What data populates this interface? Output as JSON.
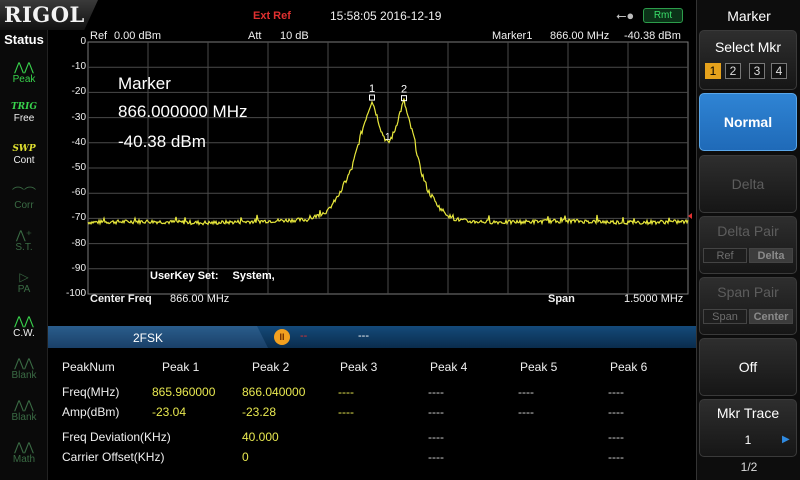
{
  "header": {
    "logo": "RIGOL",
    "ext_ref": "Ext Ref",
    "datetime": "15:58:05 2016-12-19",
    "usb_icon": "usb-icon",
    "rmt": "Rmt"
  },
  "status": {
    "title": "Status",
    "items": [
      {
        "icon": "peak-icon",
        "label": "Peak",
        "on": true
      },
      {
        "text": "TRIG",
        "label": "Free",
        "on": true
      },
      {
        "text": "SWP",
        "label": "Cont",
        "on": true
      },
      {
        "icon": "corr-icon",
        "label": "Corr",
        "on": false
      },
      {
        "icon": "st-icon",
        "label": "S.T.",
        "on": false
      },
      {
        "icon": "pa-icon",
        "label": "PA",
        "on": false
      },
      {
        "icon": "cw-icon",
        "label": "C.W.",
        "on": true
      },
      {
        "icon": "blank-icon",
        "label": "Blank",
        "on": false
      },
      {
        "icon": "blank-icon",
        "label": "Blank",
        "on": false
      },
      {
        "icon": "math-icon",
        "label": "Math",
        "on": false
      }
    ]
  },
  "plot": {
    "ref_label": "Ref",
    "ref_value": "0.00 dBm",
    "att_label": "Att",
    "att_value": "10 dB",
    "marker_hdr_label": "Marker1",
    "marker_hdr_freq": "866.00 MHz",
    "marker_hdr_amp": "-40.38 dBm",
    "y_ticks": [
      "0",
      "-10",
      "-20",
      "-30",
      "-40",
      "-50",
      "-60",
      "-70",
      "-80",
      "-90",
      "-100"
    ],
    "marker_info": [
      "Marker",
      "866.000000 MHz",
      "-40.38 dBm"
    ],
    "userkey_label": "UserKey Set:",
    "userkey_value": "System,",
    "center_label": "Center Freq",
    "center_value": "866.00 MHz",
    "span_label": "Span",
    "span_value": "1.5000 MHz",
    "trace_color": "#e8e83c",
    "marker_labels": [
      "1",
      "2",
      "1"
    ]
  },
  "chart_data": {
    "type": "line",
    "x_center_mhz": 866.0,
    "x_span_mhz": 1.5,
    "ylim": [
      -100,
      0
    ],
    "grid": true,
    "series": [
      {
        "x": [
          865.25,
          865.4,
          865.55,
          865.7,
          865.8,
          865.85,
          865.88,
          865.91,
          865.93,
          865.945,
          865.96,
          865.97,
          865.985,
          866.0,
          866.015,
          866.03,
          866.04,
          866.05,
          866.065,
          866.08,
          866.1,
          866.13,
          866.16,
          866.2,
          866.3,
          866.45,
          866.6,
          866.75
        ],
        "y": [
          -71.5,
          -71.2,
          -71.8,
          -71.0,
          -70.5,
          -67,
          -60,
          -50,
          -38,
          -30,
          -23.04,
          -28,
          -36,
          -40.38,
          -36,
          -28,
          -23.28,
          -30,
          -38,
          -50,
          -59,
          -66,
          -70,
          -71.2,
          -71.5,
          -71.0,
          -71.6,
          -71.3
        ]
      }
    ],
    "markers": [
      {
        "label": "1",
        "freq": 865.96,
        "amp": -23.04
      },
      {
        "label": "2",
        "freq": 866.04,
        "amp": -23.28
      },
      {
        "label": "1",
        "freq": 866.0,
        "amp": -40.38
      }
    ]
  },
  "measurement": {
    "name": "2FSK",
    "pause_symbol": "II",
    "pause_dashes": "--",
    "status": "---"
  },
  "results": {
    "headers": [
      "PeakNum",
      "Peak 1",
      "Peak 2",
      "Peak 3",
      "Peak 4",
      "Peak 5",
      "Peak 6"
    ],
    "rows": [
      {
        "label": "Freq(MHz)",
        "values": [
          "865.960000",
          "866.040000",
          "----",
          "----",
          "----",
          "----"
        ]
      },
      {
        "label": "Amp(dBm)",
        "values": [
          "-23.04",
          "-23.28",
          "----",
          "----",
          "----",
          "----"
        ]
      }
    ],
    "deviation": {
      "label": "Freq Deviation(KHz)",
      "value": "40.000",
      "d1": "----",
      "d2": "----"
    },
    "offset": {
      "label": "Carrier Offset(KHz)",
      "value": "0",
      "d1": "----",
      "d2": "----"
    }
  },
  "menu": {
    "title": "Marker",
    "select_mkr": "Select Mkr",
    "mkr_numbers": [
      "1",
      "2",
      "3",
      "4"
    ],
    "normal": "Normal",
    "delta": "Delta",
    "delta_pair": "Delta Pair",
    "delta_pair_opts": [
      "Ref",
      "Delta"
    ],
    "span_pair": "Span Pair",
    "span_pair_opts": [
      "Span",
      "Center"
    ],
    "off": "Off",
    "mkr_trace": "Mkr Trace",
    "mkr_trace_value": "1",
    "page": "1/2"
  }
}
